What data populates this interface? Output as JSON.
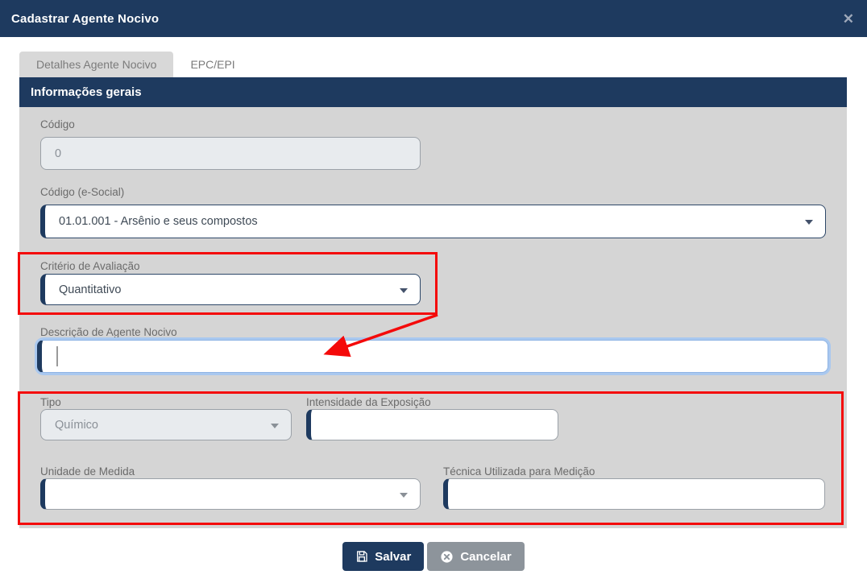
{
  "modal": {
    "title": "Cadastrar Agente Nocivo",
    "close_glyph": "✕"
  },
  "tabs": [
    {
      "label": "Detalhes Agente Nocivo",
      "active": true
    },
    {
      "label": "EPC/EPI",
      "active": false
    }
  ],
  "section": {
    "title": "Informações gerais"
  },
  "fields": {
    "codigo": {
      "label": "Código",
      "value": "0",
      "disabled": true
    },
    "codigo_esocial": {
      "label": "Código (e-Social)",
      "value": "01.01.001 - Arsênio e seus compostos"
    },
    "criterio": {
      "label": "Critério de Avaliação",
      "value": "Quantitativo"
    },
    "descricao": {
      "label": "Descrição de Agente Nocivo",
      "value": "",
      "focused": true
    },
    "tipo": {
      "label": "Tipo",
      "value": "Químico",
      "disabled": true
    },
    "intensidade": {
      "label": "Intensidade da Exposição",
      "value": ""
    },
    "unidade": {
      "label": "Unidade de Medida",
      "value": ""
    },
    "tecnica": {
      "label": "Técnica Utilizada para Medição",
      "value": ""
    }
  },
  "buttons": {
    "save": "Salvar",
    "cancel": "Cancelar"
  },
  "icons": {
    "save": "floppy-disk-icon",
    "cancel": "circle-x-icon",
    "close": "close-x-icon",
    "selects": "chevron-down-icon"
  },
  "annotations": {
    "highlight_color": "#f40a0a",
    "box1_target": "Critério de Avaliação",
    "box2_target": "Tipo / Intensidade / Unidade / Técnica group",
    "arrow_target": "Descrição de Agente Nocivo"
  },
  "colors": {
    "navy": "#1e3a5f",
    "body_gray": "#d5d5d5",
    "disabled_fill": "#e8ebee",
    "focus_glow": "#a9c8ef",
    "cancel_gray": "#8d949b",
    "annotation_red": "#f40a0a"
  }
}
